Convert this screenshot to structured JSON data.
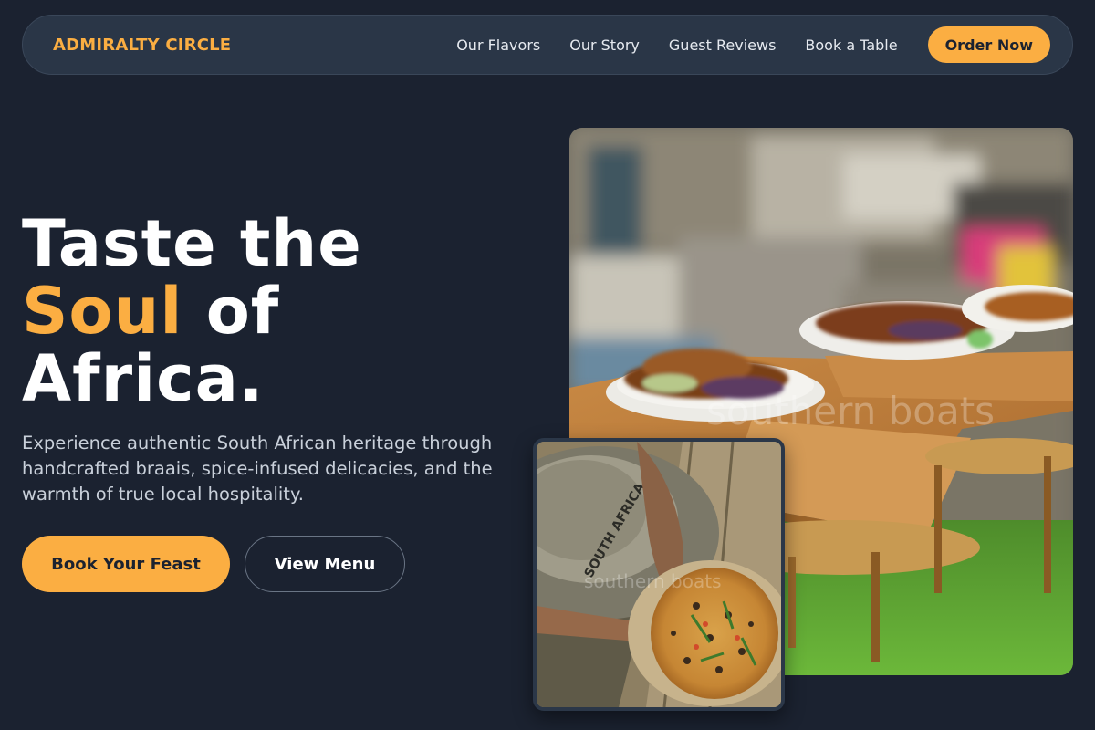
{
  "brand": {
    "name": "ADMIRALTY CIRCLE"
  },
  "nav": {
    "links": [
      "Our Flavors",
      "Our Story",
      "Guest Reviews",
      "Book a Table"
    ],
    "cta": "Order Now"
  },
  "hero": {
    "title_line1": "Taste the",
    "title_accent": "Soul",
    "title_line2_rest": "of",
    "title_line3": "Africa.",
    "description": "Experience authentic South African heritage through handcrafted braais, spice-infused delicacies, and the warmth of true local hospitality.",
    "primary_button": "Book Your Feast",
    "secondary_button": "View Menu"
  },
  "images": {
    "main_watermark": "southern boats",
    "small_watermark": "southern boats",
    "hat_text": "SOUTH AFRICA"
  },
  "colors": {
    "background": "#1b2230",
    "accent": "#fbae42",
    "nav_background": "#2a3647"
  }
}
